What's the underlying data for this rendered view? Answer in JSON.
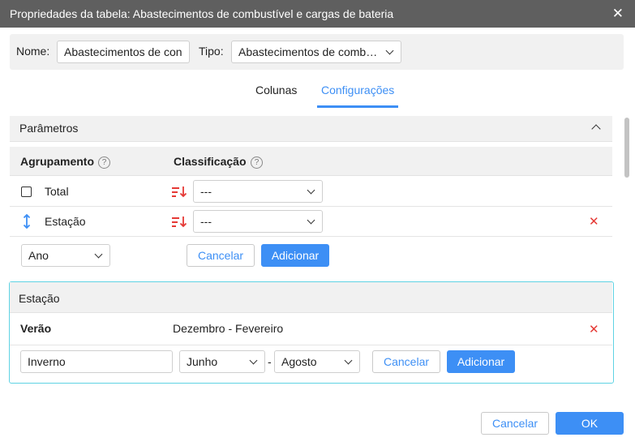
{
  "window": {
    "title": "Propriedades da tabela: Abastecimentos de combustível e cargas de bateria",
    "close_glyph": "✕"
  },
  "name_bar": {
    "name_label": "Nome:",
    "name_value": "Abastecimentos de con",
    "type_label": "Tipo:",
    "type_value": "Abastecimentos de comb…"
  },
  "tabs": [
    {
      "label": "Colunas",
      "active": false
    },
    {
      "label": "Configurações",
      "active": true
    }
  ],
  "parameters": {
    "title": "Parâmetros",
    "grouping_header": "Agrupamento",
    "sorting_header": "Classificação",
    "help_glyph": "?",
    "rows": [
      {
        "label": "Total",
        "sort_value": "---",
        "has_checkbox": true,
        "removable": false
      },
      {
        "label": "Estação",
        "sort_value": "---",
        "has_checkbox": false,
        "removable": true
      }
    ],
    "add_row": {
      "select_value": "Ano",
      "cancel_label": "Cancelar",
      "add_label": "Adicionar"
    }
  },
  "station": {
    "title": "Estação",
    "entries": [
      {
        "name": "Verão",
        "range": "Dezembro - Fevereiro"
      }
    ],
    "new_entry": {
      "name_value": "Inverno",
      "from_value": "Junho",
      "separator": "-",
      "to_value": "Agosto",
      "cancel_label": "Cancelar",
      "add_label": "Adicionar"
    }
  },
  "footer": {
    "cancel_label": "Cancelar",
    "ok_label": "OK"
  },
  "colors": {
    "accent": "#3d8ff5",
    "danger": "#e53935",
    "titlebar": "#5f5f5f",
    "highlight_border": "#5fd3e4"
  },
  "icons": {
    "remove": "✕"
  }
}
